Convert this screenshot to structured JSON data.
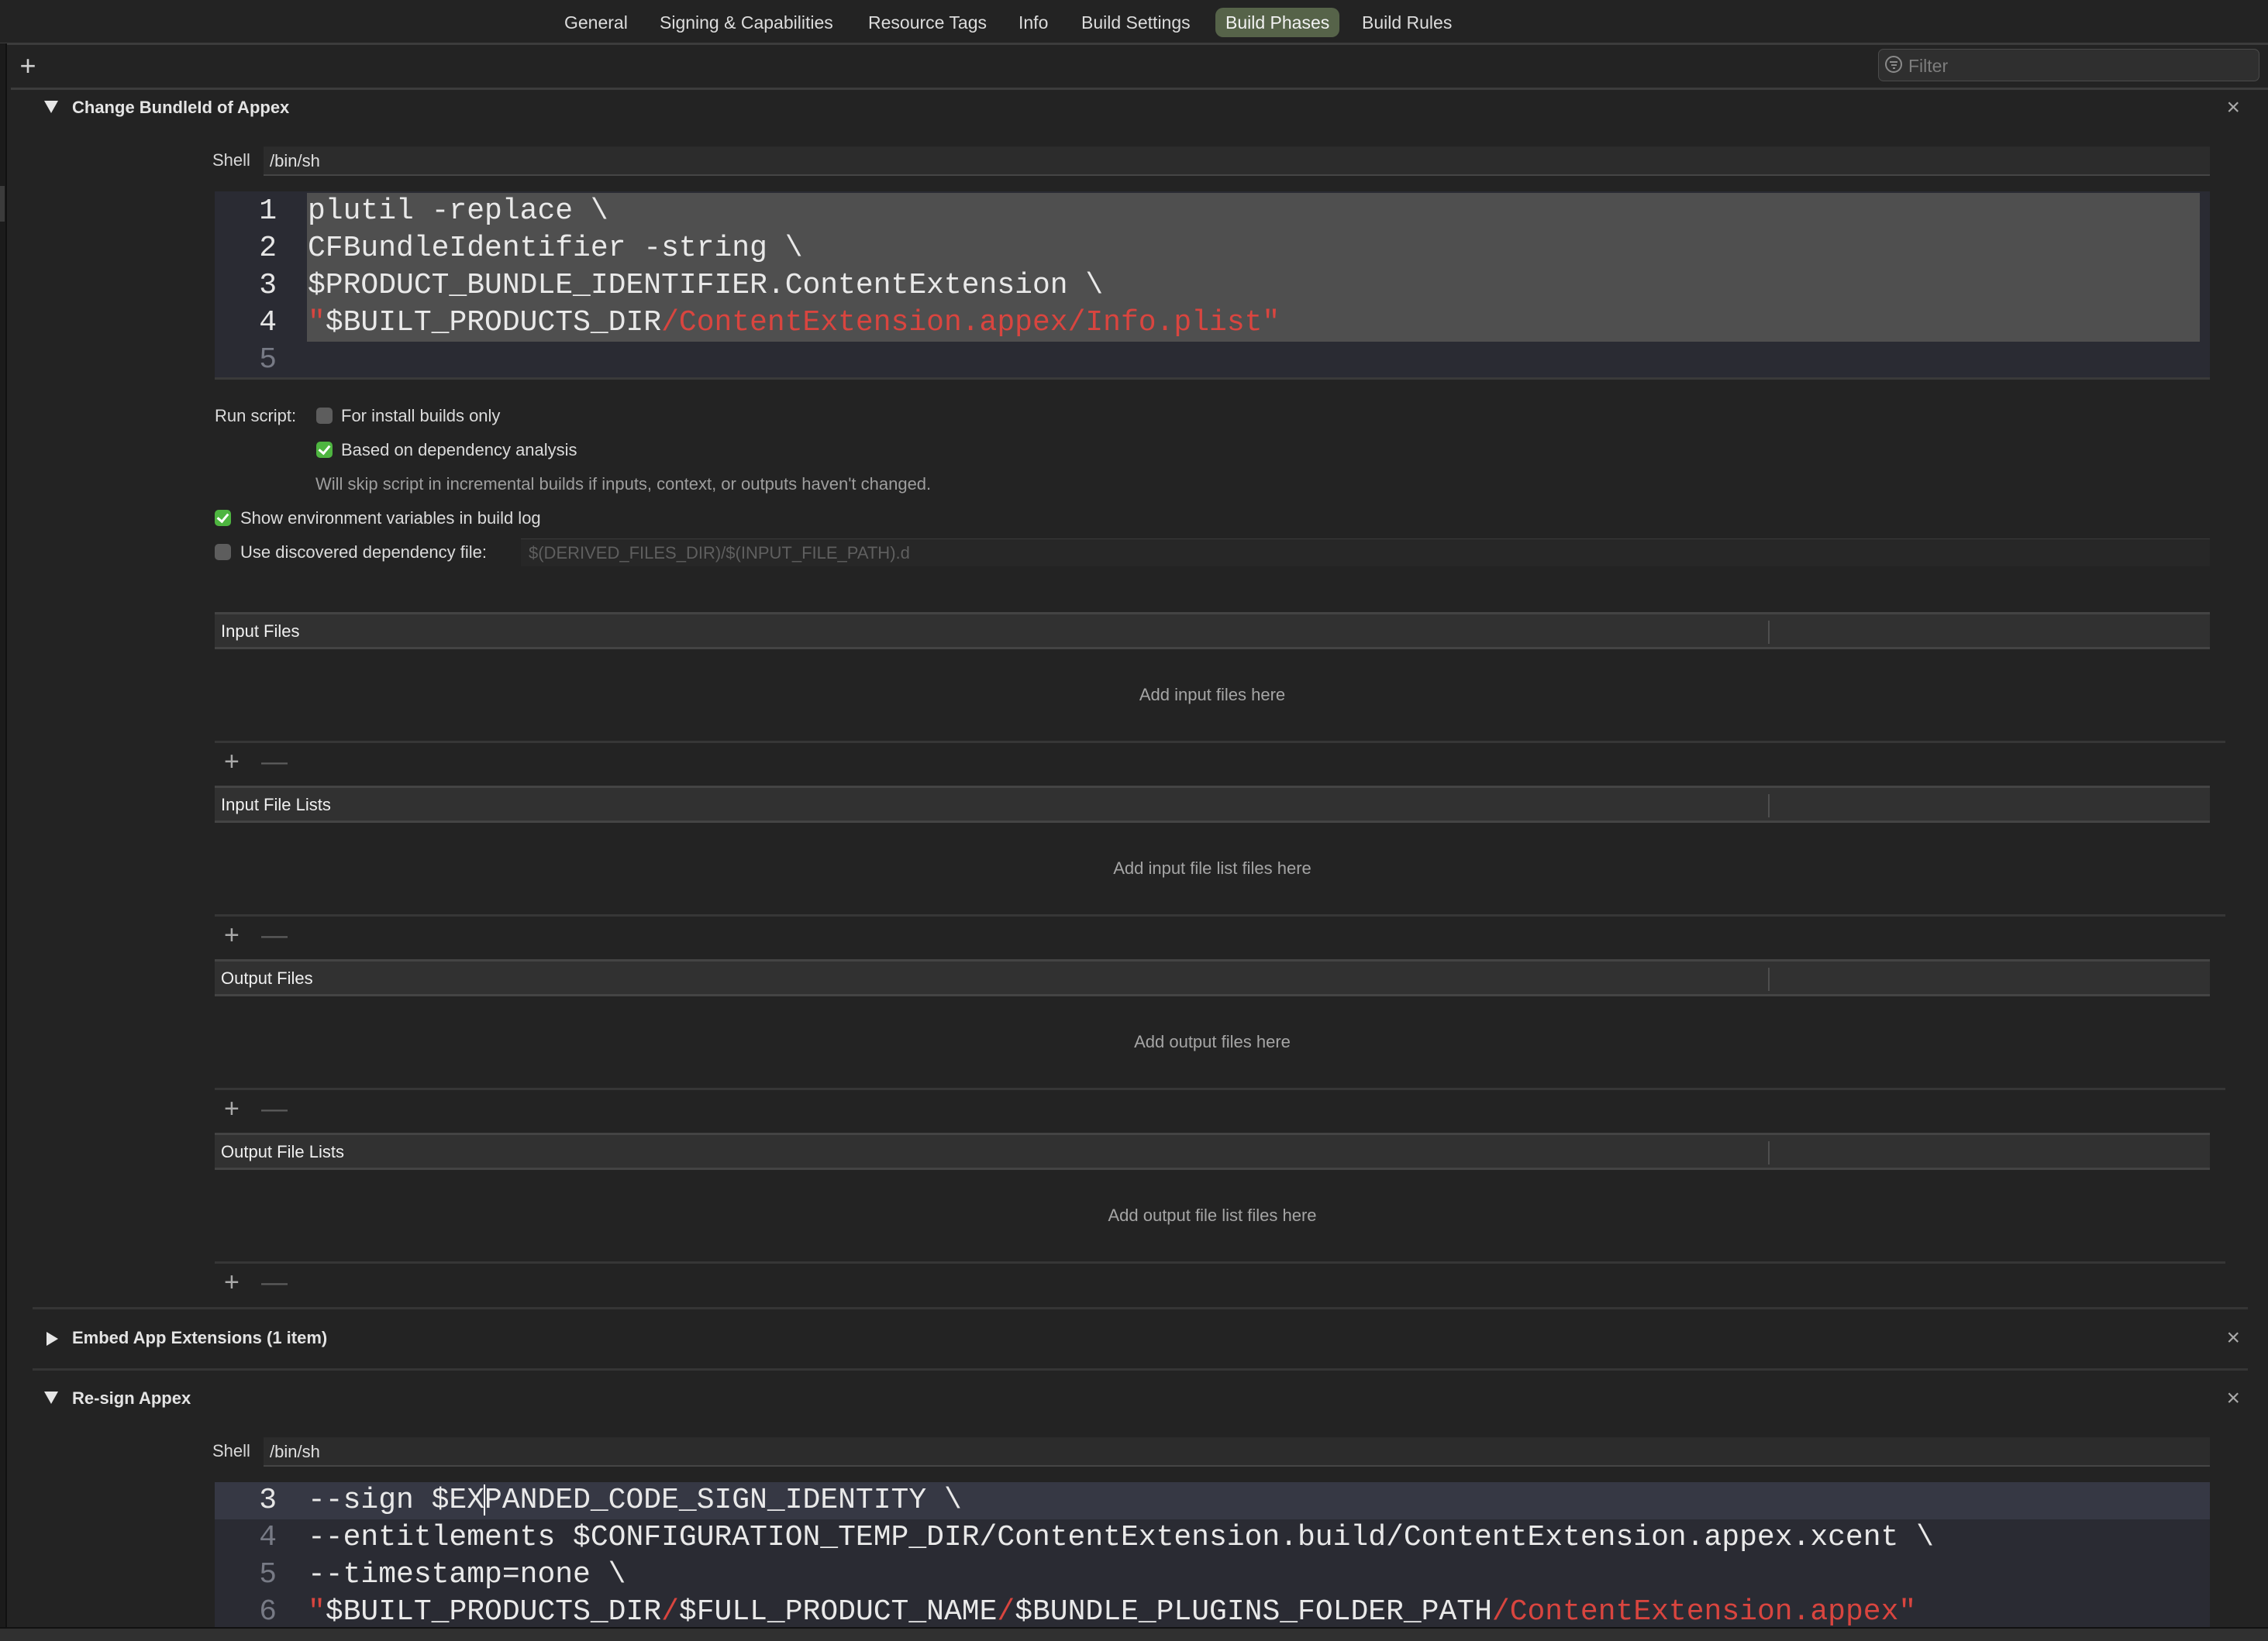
{
  "tabs": [
    {
      "label": "General",
      "active": false
    },
    {
      "label": "Signing & Capabilities",
      "active": false
    },
    {
      "label": "Resource Tags",
      "active": false
    },
    {
      "label": "Info",
      "active": false
    },
    {
      "label": "Build Settings",
      "active": false
    },
    {
      "label": "Build Phases",
      "active": true
    },
    {
      "label": "Build Rules",
      "active": false
    }
  ],
  "toolbar": {
    "add_icon": "plus-icon",
    "filter_placeholder": "Filter",
    "filter_value": "",
    "filter_icon": "filter-icon"
  },
  "phases": [
    {
      "title": "Change BundleId of Appex",
      "expanded": true,
      "close_icon": "close-icon",
      "shell_label": "Shell",
      "shell_value": "/bin/sh",
      "code_lines": [
        {
          "n": "1",
          "segments": [
            {
              "t": "plutil -replace \\",
              "c": "plain"
            }
          ]
        },
        {
          "n": "2",
          "segments": [
            {
              "t": "CFBundleIdentifier -string \\",
              "c": "plain"
            }
          ]
        },
        {
          "n": "3",
          "segments": [
            {
              "t": "$PRODUCT_BUNDLE_IDENTIFIER.ContentExtension \\",
              "c": "plain"
            }
          ]
        },
        {
          "n": "4",
          "segments": [
            {
              "t": "\"",
              "c": "str"
            },
            {
              "t": "$BUILT_PRODUCTS_DIR",
              "c": "plain"
            },
            {
              "t": "/ContentExtension.appex/Info.plist\"",
              "c": "str"
            }
          ]
        },
        {
          "n": "5",
          "segments": []
        }
      ],
      "run_script_label": "Run script:",
      "install_builds_only": {
        "label": "For install builds only",
        "checked": false
      },
      "dependency_analysis": {
        "label": "Based on dependency analysis",
        "checked": true
      },
      "dependency_hint": "Will skip script in incremental builds if inputs, context, or outputs haven't changed.",
      "show_env_vars": {
        "label": "Show environment variables in build log",
        "checked": true
      },
      "discovered_dep_file": {
        "label": "Use discovered dependency file:",
        "checked": false,
        "placeholder": "$(DERIVED_FILES_DIR)/$(INPUT_FILE_PATH).d",
        "value": ""
      },
      "file_tables": [
        {
          "title": "Input Files",
          "empty_text": "Add input files here"
        },
        {
          "title": "Input File Lists",
          "empty_text": "Add input file list files here"
        },
        {
          "title": "Output Files",
          "empty_text": "Add output files here"
        },
        {
          "title": "Output File Lists",
          "empty_text": "Add output file list files here"
        }
      ]
    },
    {
      "title": "Embed App Extensions (1 item)",
      "expanded": false,
      "close_icon": "close-icon"
    },
    {
      "title": "Re-sign Appex",
      "expanded": true,
      "close_icon": "close-icon",
      "shell_label": "Shell",
      "shell_value": "/bin/sh",
      "code_lines": [
        {
          "n": "3",
          "segments": [
            {
              "t": "--sign $EX",
              "c": "plain"
            },
            {
              "t": "PANDED_CODE_SIGN_IDENTITY \\",
              "c": "plain"
            }
          ]
        },
        {
          "n": "4",
          "segments": [
            {
              "t": "--entitlements $CONFIGURATION_TEMP_DIR/ContentExtension.build/ContentExtension.appex.xcent \\",
              "c": "plain"
            }
          ]
        },
        {
          "n": "5",
          "segments": [
            {
              "t": "--timestamp=none \\",
              "c": "plain"
            }
          ]
        },
        {
          "n": "6",
          "segments": [
            {
              "t": "\"",
              "c": "str"
            },
            {
              "t": "$BUILT_PRODUCTS_DIR",
              "c": "plain"
            },
            {
              "t": "/",
              "c": "str"
            },
            {
              "t": "$FULL_PRODUCT_NAME",
              "c": "plain"
            },
            {
              "t": "/",
              "c": "str"
            },
            {
              "t": "$BUNDLE_PLUGINS_FOLDER_PATH",
              "c": "plain"
            },
            {
              "t": "/ContentExtension.appex\"",
              "c": "str"
            }
          ]
        }
      ]
    }
  ],
  "colors": {
    "background": "#232323",
    "active_tab": "#566349",
    "checkbox_on": "#4eb540",
    "string_literal": "#d9453f",
    "selection": "#4f4f4f",
    "editor_bg": "#2a2b33"
  }
}
